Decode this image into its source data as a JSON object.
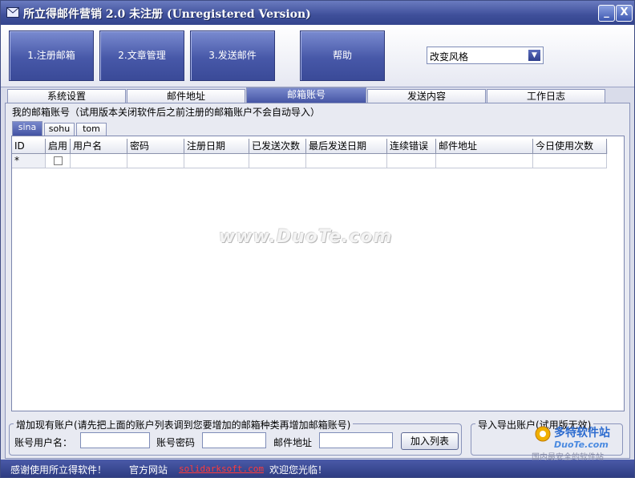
{
  "window": {
    "title": "所立得邮件营销 2.0 未注册 (Unregistered Version)",
    "minimize_glyph": "_",
    "close_glyph": "X"
  },
  "toolbar": {
    "buttons": [
      "1.注册邮箱",
      "2.文章管理",
      "3.发送邮件",
      "帮助"
    ],
    "style_combo_value": "改变风格"
  },
  "main_tabs": {
    "items": [
      "系统设置",
      "邮件地址",
      "邮箱账号",
      "发送内容",
      "工作日志"
    ],
    "active": "邮箱账号"
  },
  "accounts_group": {
    "label": "我的邮箱账号（试用版本关闭软件后之前注册的邮箱账户不会自动导入）"
  },
  "sub_tabs": {
    "items": [
      "sina",
      "sohu",
      "tom"
    ],
    "active": "sina"
  },
  "grid": {
    "columns": [
      "ID",
      "启用",
      "用户名",
      "密码",
      "注册日期",
      "已发送次数",
      "最后发送日期",
      "连续错误",
      "邮件地址",
      "今日使用次数"
    ],
    "new_row_marker": "*"
  },
  "watermark": "www.DuoTe.com",
  "add_group": {
    "legend": "增加现有账户(请先把上面的账户列表调到您要增加的邮箱种类再增加邮箱账号)",
    "username_label": "账号用户名：",
    "password_label": "账号密码",
    "email_label": "邮件地址",
    "add_button": "加入列表"
  },
  "import_group": {
    "legend": "导入导出账户(试用版无效)"
  },
  "statusbar": {
    "thanks": "感谢使用所立得软件！",
    "site_label": "官方网站",
    "site_link": "solidarksoft.com",
    "welcome": "欢迎您光临！"
  },
  "corner_logo": {
    "brand": "多特软件站",
    "domain": "DuoTe.com",
    "slogan": "国内最安全的软件站"
  },
  "colors": {
    "accent": "#4353a3",
    "titlebar": "#3e4f9a",
    "link": "#ff3b3b"
  }
}
